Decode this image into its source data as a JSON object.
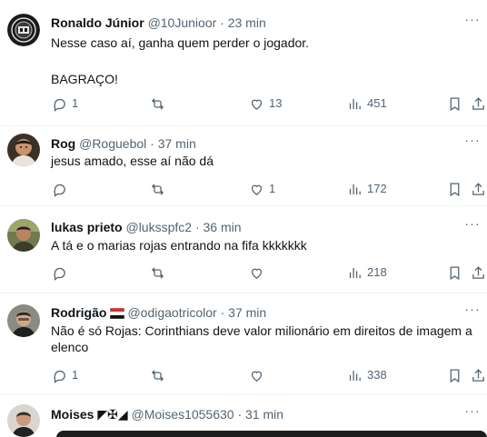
{
  "tweets": [
    {
      "name": "Ronaldo Júnior",
      "handle": "@10Junioor",
      "sep": "·",
      "time": "23 min",
      "lines": [
        "Nesse caso aí, ganha quem perder o jogador.",
        "",
        "BAGRAÇO!"
      ],
      "replies": "1",
      "retweets": "",
      "likes": "13",
      "views": "451"
    },
    {
      "name": "Rog",
      "handle": "@Roguebol",
      "sep": "·",
      "time": "37 min",
      "lines": [
        "jesus amado, esse aí não dá"
      ],
      "replies": "",
      "retweets": "",
      "likes": "1",
      "views": "172"
    },
    {
      "name": "lukas prieto",
      "handle": "@luksspfc2",
      "sep": "·",
      "time": "36 min",
      "lines": [
        "A tá e o marias rojas entrando na fifa kkkkkkk"
      ],
      "replies": "",
      "retweets": "",
      "likes": "",
      "views": "218"
    },
    {
      "name": "Rodrigão",
      "handle": "@odigaotricolor",
      "sep": "·",
      "time": "37 min",
      "lines": [
        "Não é só Rojas: Corinthians deve valor milionário em direitos de imagem a",
        "elenco"
      ],
      "replies": "1",
      "retweets": "",
      "likes": "",
      "views": "338"
    },
    {
      "name": "Moises ◤✠◢",
      "handle": "@Moises1055630",
      "sep": "·",
      "time": "31 min",
      "lines": []
    }
  ],
  "more_label": "···",
  "colors": {
    "text": "#0f1419",
    "muted": "#536471",
    "divider": "#eff3f4"
  }
}
